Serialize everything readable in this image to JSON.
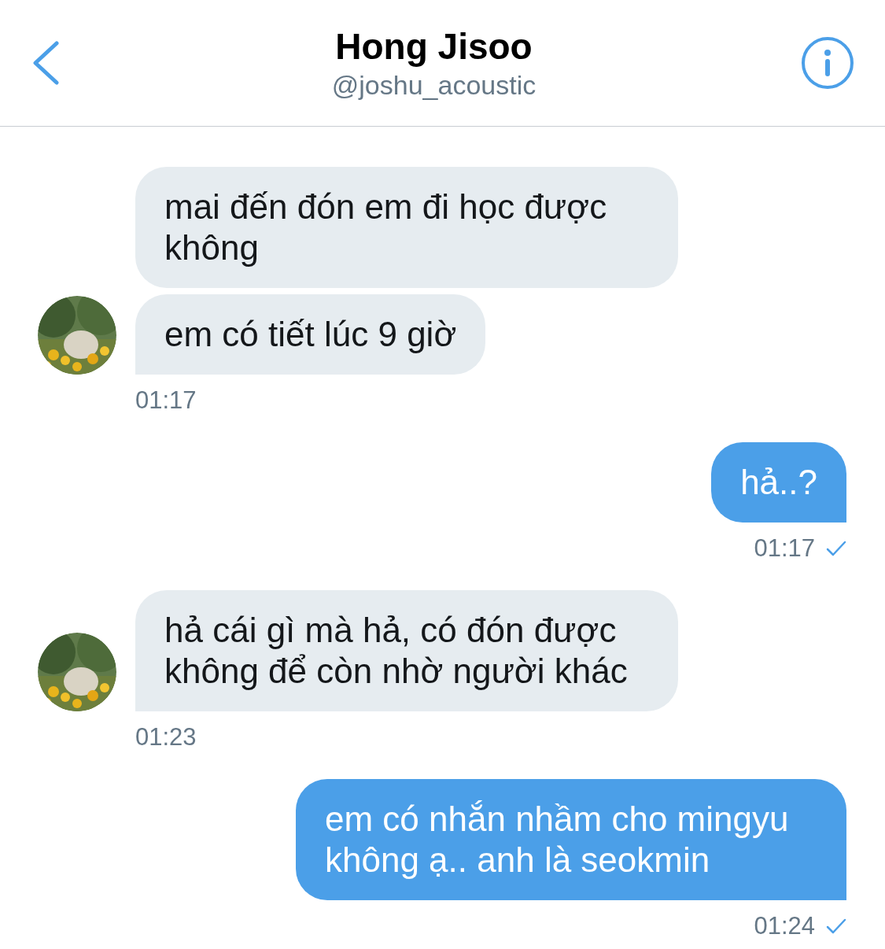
{
  "header": {
    "title": "Hong Jisoo",
    "handle": "@joshu_acoustic"
  },
  "messages": [
    {
      "kind": "received",
      "bubbles": [
        "mai đến đón em đi học được không",
        "em có tiết lúc 9 giờ"
      ],
      "time": "01:17"
    },
    {
      "kind": "sent",
      "bubbles": [
        "hả..?"
      ],
      "time": "01:17"
    },
    {
      "kind": "received",
      "bubbles": [
        "hả cái gì mà hả, có đón được không để còn nhờ người khác"
      ],
      "time": "01:23"
    },
    {
      "kind": "sent",
      "bubbles": [
        "em có nhắn nhầm cho mingyu không ạ.. anh là seokmin"
      ],
      "time": "01:24"
    }
  ]
}
